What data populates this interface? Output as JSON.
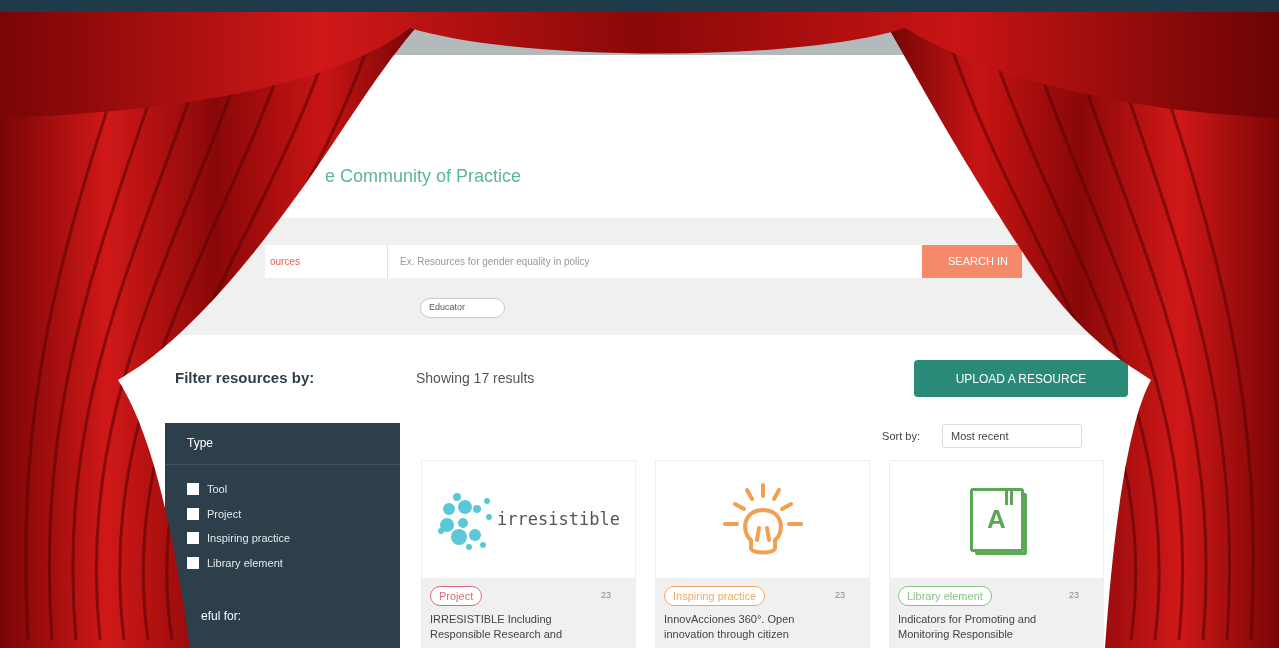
{
  "header": {
    "title": "e Community of Practice"
  },
  "search": {
    "scope": "ources",
    "placeholder": "Ex. Resources for gender equality in policy",
    "button": "SEARCH IN"
  },
  "chips": [
    "Educator"
  ],
  "filter_title": "Filter resources by:",
  "results": "Showing 17 results",
  "upload_button": "UPLOAD A RESOURCE",
  "sidebar": {
    "section": "Type",
    "options": [
      {
        "label": "Tool",
        "checked": false
      },
      {
        "label": "Project",
        "checked": false
      },
      {
        "label": "Inspiring practice",
        "checked": false
      },
      {
        "label": "Library element",
        "checked": false
      }
    ],
    "next_section": "eful for:"
  },
  "sort": {
    "label": "Sort by:",
    "value": "Most recent"
  },
  "cards": [
    {
      "image": {
        "kind": "logo",
        "text": "irresistible"
      },
      "tag": {
        "label": "Project",
        "color": "#e06a7a"
      },
      "count": "23",
      "title": "IRRESISTIBLE Including\nResponsible Research and"
    },
    {
      "image": {
        "kind": "bulb"
      },
      "tag": {
        "label": "Inspiring practice",
        "color": "#f0a868"
      },
      "count": "23",
      "title": "InnovAcciones 360°. Open\ninnovation through citizen"
    },
    {
      "image": {
        "kind": "book",
        "letter": "A"
      },
      "tag": {
        "label": "Library element",
        "color": "#86c383"
      },
      "count": "23",
      "title": "Indicators for Promoting and\nMonitoring Responsible"
    }
  ]
}
